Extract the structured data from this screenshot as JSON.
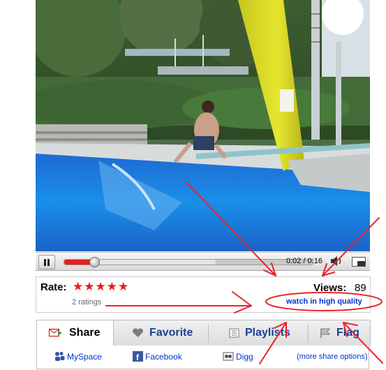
{
  "player": {
    "time_display": "0:02 / 0:16",
    "progress_played": 0.12,
    "progress_buffered": 0.61,
    "state": "playing",
    "icons": {
      "pause": "pause-icon",
      "volume": "volume-icon",
      "resize": "window-size-icon"
    }
  },
  "rating": {
    "label": "Rate:",
    "stars_filled": 5,
    "stars_total": 5,
    "star_glyph": "★",
    "star_color": "#e41b1b",
    "count_text": "2 ratings",
    "views_label": "Views:",
    "views_value": "89",
    "hq_link": "watch in high quality"
  },
  "tabs": [
    {
      "label": "Share",
      "icon": "share-envelope-icon",
      "active": true
    },
    {
      "label": "Favorite",
      "icon": "heart-icon",
      "active": false
    },
    {
      "label": "Playlists",
      "icon": "playlist-icon",
      "active": false
    },
    {
      "label": "Flag",
      "icon": "flag-icon",
      "active": false
    }
  ],
  "share_links": [
    {
      "label": "MySpace",
      "icon": "myspace-icon"
    },
    {
      "label": "Facebook",
      "icon": "facebook-icon"
    },
    {
      "label": "Digg",
      "icon": "digg-icon"
    }
  ],
  "more_share_options": "(more share options)",
  "colors": {
    "annotation_red": "#e8232a",
    "link_blue": "#0033cc",
    "tab_text_blue": "#1b3f93",
    "seek_red": "#e02020"
  }
}
